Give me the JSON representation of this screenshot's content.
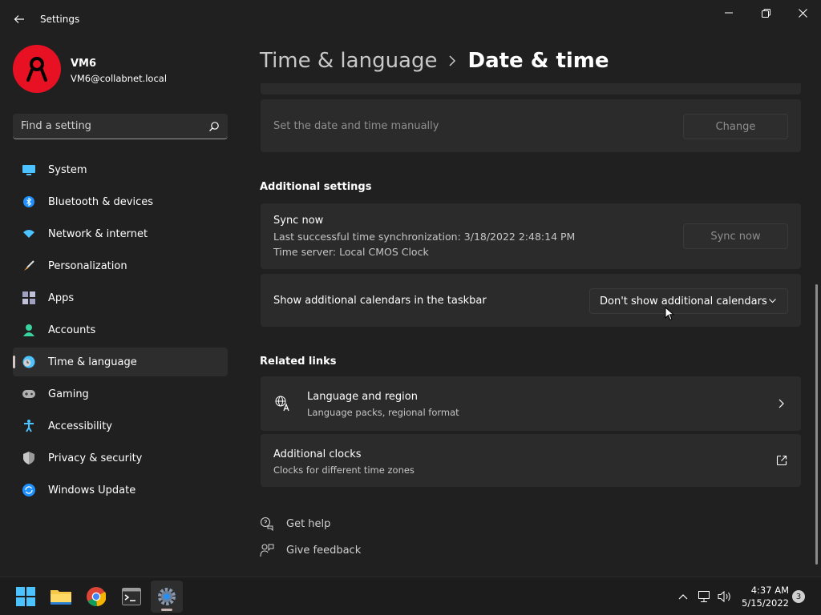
{
  "window": {
    "title": "Settings"
  },
  "profile": {
    "name": "VM6",
    "email": "VM6@collabnet.local"
  },
  "search": {
    "placeholder": "Find a setting"
  },
  "sidebar": {
    "items": [
      {
        "label": "System",
        "icon": "monitor-icon"
      },
      {
        "label": "Bluetooth & devices",
        "icon": "bluetooth-icon"
      },
      {
        "label": "Network & internet",
        "icon": "wifi-icon"
      },
      {
        "label": "Personalization",
        "icon": "brush-icon"
      },
      {
        "label": "Apps",
        "icon": "apps-icon"
      },
      {
        "label": "Accounts",
        "icon": "person-icon"
      },
      {
        "label": "Time & language",
        "icon": "clock-globe-icon",
        "active": true
      },
      {
        "label": "Gaming",
        "icon": "gamepad-icon"
      },
      {
        "label": "Accessibility",
        "icon": "accessibility-icon"
      },
      {
        "label": "Privacy & security",
        "icon": "shield-icon"
      },
      {
        "label": "Windows Update",
        "icon": "update-icon"
      }
    ]
  },
  "header": {
    "parent": "Time & language",
    "current": "Date & time"
  },
  "manual_time": {
    "label": "Set the date and time manually",
    "button": "Change"
  },
  "additional_settings": {
    "title": "Additional settings",
    "sync": {
      "label": "Sync now",
      "last_sync": "Last successful time synchronization: 3/18/2022 2:48:14 PM",
      "server": "Time server: Local CMOS Clock",
      "button": "Sync now"
    },
    "calendars": {
      "label": "Show additional calendars in the taskbar",
      "selected": "Don't show additional calendars"
    }
  },
  "related_links": {
    "title": "Related links",
    "language_region": {
      "label": "Language and region",
      "sub": "Language packs, regional format"
    },
    "additional_clocks": {
      "label": "Additional clocks",
      "sub": "Clocks for different time zones"
    }
  },
  "help": {
    "get_help": "Get help",
    "give_feedback": "Give feedback"
  },
  "taskbar": {
    "apps": [
      "windows-start-icon",
      "file-explorer-icon",
      "chrome-icon",
      "terminal-icon",
      "settings-icon"
    ],
    "clock": {
      "time": "4:37 AM",
      "date": "5/15/2022"
    },
    "notification_count": "3"
  },
  "colors": {
    "avatar": "#e81123",
    "background": "#202020",
    "card": "#2b2b2b",
    "accent": "#60cdff"
  }
}
